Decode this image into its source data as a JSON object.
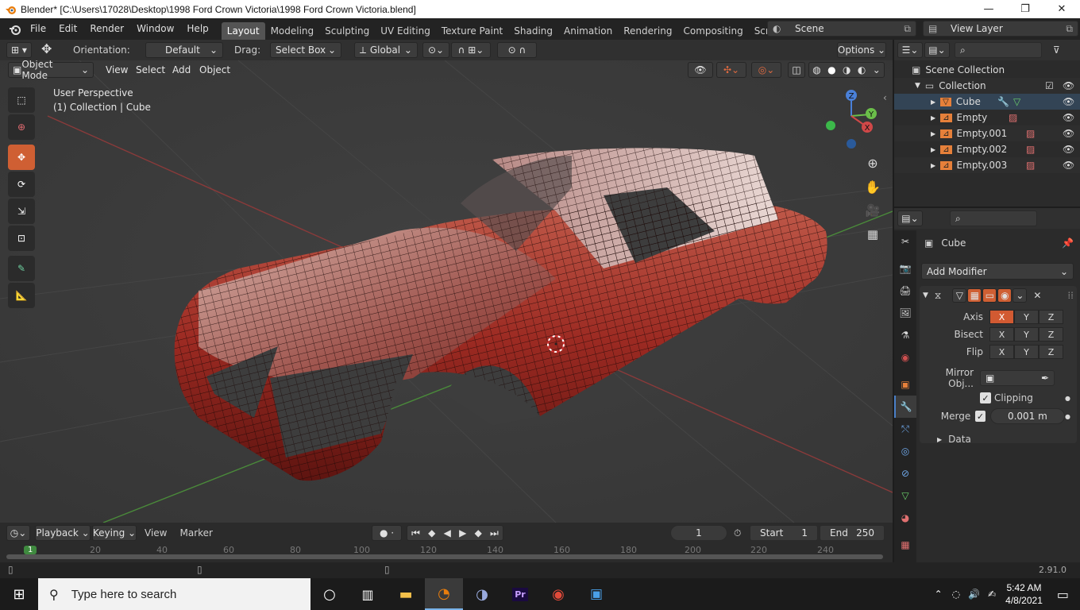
{
  "window": {
    "title": "Blender* [C:\\Users\\17028\\Desktop\\1998 Ford Crown Victoria\\1998 Ford Crown Victoria.blend]",
    "minimize": "—",
    "maximize": "❐",
    "close": "✕"
  },
  "menu": [
    "File",
    "Edit",
    "Render",
    "Window",
    "Help"
  ],
  "workspaces": [
    "Layout",
    "Modeling",
    "Sculpting",
    "UV Editing",
    "Texture Paint",
    "Shading",
    "Animation",
    "Rendering",
    "Compositing",
    "Scripting"
  ],
  "active_workspace": "Layout",
  "scene_name": "Scene",
  "view_layer": "View Layer",
  "tool_header": {
    "orientation_label": "Orientation:",
    "orientation_value": "Default",
    "drag_label": "Drag:",
    "drag_value": "Select Box",
    "transform_orientation": "Global",
    "options": "Options"
  },
  "viewport": {
    "mode": "Object Mode",
    "menus": [
      "View",
      "Select",
      "Add",
      "Object"
    ],
    "perspective": "User Perspective",
    "context": "(1) Collection | Cube",
    "gizmo": {
      "x": "X",
      "y": "Y",
      "z": "Z"
    }
  },
  "outliner": {
    "scene_collection": "Scene Collection",
    "collection": "Collection",
    "items": [
      {
        "name": "Cube"
      },
      {
        "name": "Empty"
      },
      {
        "name": "Empty.001"
      },
      {
        "name": "Empty.002"
      },
      {
        "name": "Empty.003"
      }
    ]
  },
  "properties": {
    "object_name": "Cube",
    "add_modifier": "Add Modifier",
    "axis_label": "Axis",
    "bisect_label": "Bisect",
    "flip_label": "Flip",
    "axes": [
      "X",
      "Y",
      "Z"
    ],
    "mirror_object_label": "Mirror Obj...",
    "clipping_label": "Clipping",
    "merge_label": "Merge",
    "merge_value": "0.001 m",
    "data_label": "Data"
  },
  "timeline": {
    "playback": "Playback",
    "keying": "Keying",
    "view": "View",
    "marker": "Marker",
    "current_frame": "1",
    "start_label": "Start",
    "start_value": "1",
    "end_label": "End",
    "end_value": "250",
    "ticks": [
      "20",
      "40",
      "60",
      "80",
      "100",
      "120",
      "140",
      "160",
      "180",
      "200",
      "220",
      "240"
    ],
    "current_marker": "1"
  },
  "status": {
    "version": "2.91.0"
  },
  "taskbar": {
    "search_placeholder": "Type here to search",
    "time": "5:42 AM",
    "date": "4/8/2021"
  },
  "colors": {
    "accent": "#cf5f33",
    "highlight_blue": "#4a80c8",
    "car_red": "#9c2a22"
  }
}
